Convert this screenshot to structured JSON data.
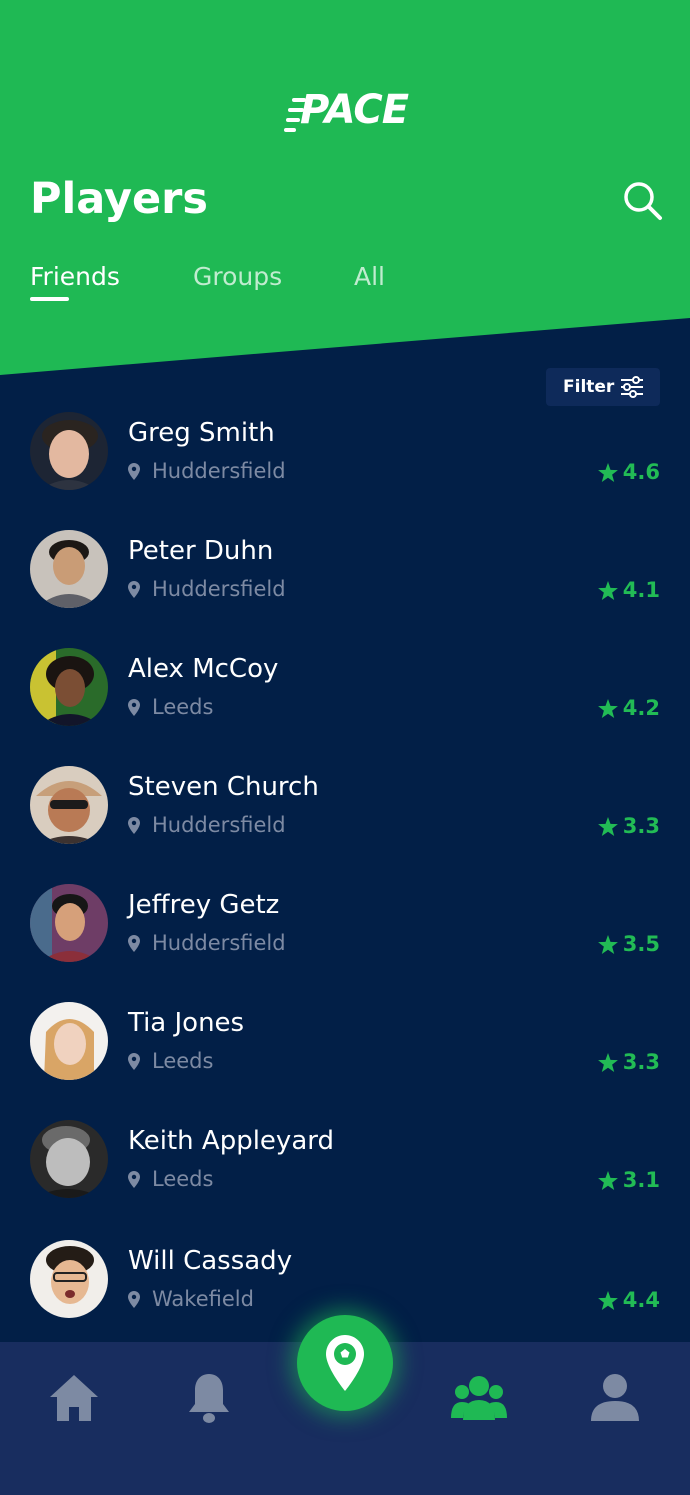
{
  "app": {
    "logo_text": "PACE"
  },
  "header": {
    "title": "Players"
  },
  "tabs": [
    {
      "label": "Friends",
      "active": true
    },
    {
      "label": "Groups",
      "active": false
    },
    {
      "label": "All",
      "active": false
    }
  ],
  "filter": {
    "label": "Filter"
  },
  "players": [
    {
      "name": "Greg Smith",
      "location": "Huddersfield",
      "rating": "4.6"
    },
    {
      "name": "Peter Duhn",
      "location": "Huddersfield",
      "rating": "4.1"
    },
    {
      "name": "Alex McCoy",
      "location": "Leeds",
      "rating": "4.2"
    },
    {
      "name": "Steven Church",
      "location": "Huddersfield",
      "rating": "3.3"
    },
    {
      "name": "Jeffrey Getz",
      "location": "Huddersfield",
      "rating": "3.5"
    },
    {
      "name": "Tia Jones",
      "location": "Leeds",
      "rating": "3.3"
    },
    {
      "name": "Keith Appleyard",
      "location": "Leeds",
      "rating": "3.1"
    },
    {
      "name": "Will Cassady",
      "location": "Wakefield",
      "rating": "4.4"
    }
  ],
  "nav": {
    "items": [
      "home-icon",
      "bell-icon",
      "map-pin-ball-icon",
      "players-icon",
      "profile-icon"
    ],
    "active": "players-icon"
  },
  "colors": {
    "brand_green": "#1fb954",
    "background": "#021f47",
    "nav_background": "#182d5f",
    "muted_text": "#7d8aa3",
    "rating": "#22bb55"
  }
}
